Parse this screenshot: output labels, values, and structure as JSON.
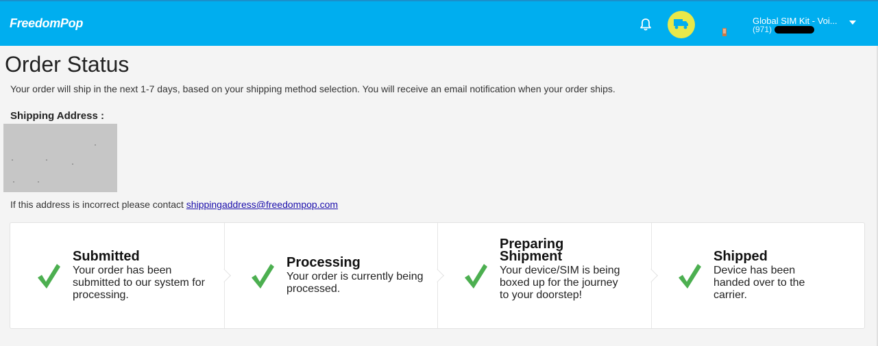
{
  "header": {
    "brand": "FreedomPop",
    "account_name": "Global SIM Kit - Voi...",
    "account_phone": "(971)",
    "icons": [
      "bell-icon",
      "truck-icon",
      "avatar",
      "chevron-down-icon"
    ],
    "colors": {
      "bar": "#00aeef",
      "truck_button": "#e8e84a",
      "check": "#4caf50"
    }
  },
  "main": {
    "title": "Order Status",
    "notice": "Your order will ship in the next 1-7 days, based on your shipping method selection. You will receive an email notification when your order ships.",
    "shipping_label": "Shipping Address :",
    "contact_text": "If this address is incorrect please contact ",
    "contact_email": "shippingaddress@freedompop.com"
  },
  "steps": [
    {
      "title": "Submitted",
      "description": "Your order has been submitted to our system for processing.",
      "status": "complete"
    },
    {
      "title": "Processing",
      "description": "Your order is currently being processed.",
      "status": "complete"
    },
    {
      "title": "Preparing Shipment",
      "description": "Your device/SIM is being boxed up for the journey to your doorstep!",
      "status": "complete"
    },
    {
      "title": "Shipped",
      "description": "Device has been handed over to the carrier.",
      "status": "complete"
    }
  ]
}
